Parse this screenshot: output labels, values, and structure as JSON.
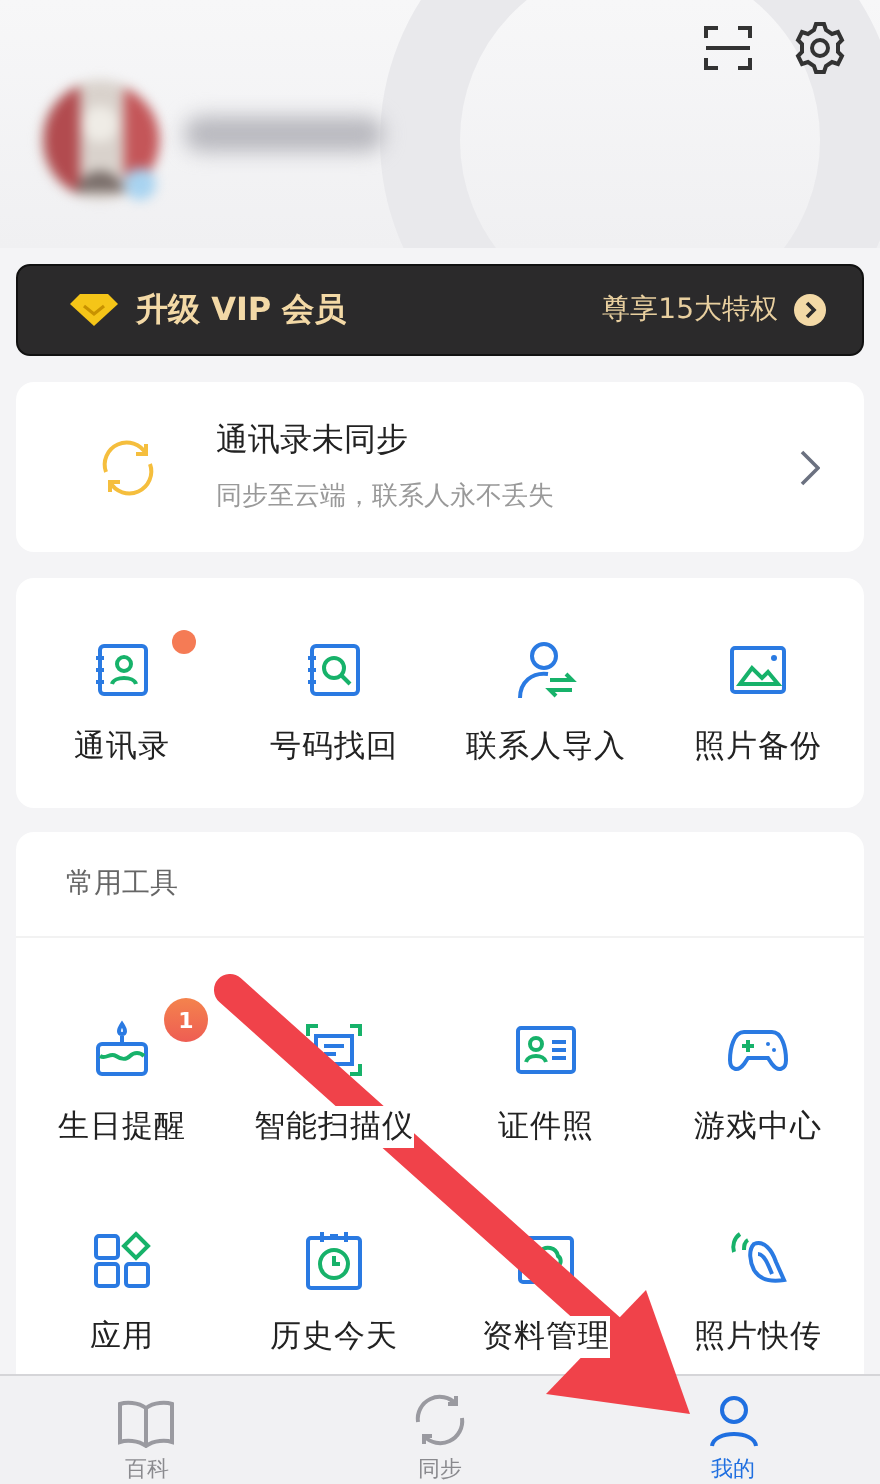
{
  "vip_bar": {
    "title": "升级 VIP 会员",
    "offer": "尊享15大特权"
  },
  "sync_card": {
    "title": "通讯录未同步",
    "subtitle": "同步至云端，联系人永不丢失"
  },
  "quick_actions": [
    {
      "label": "通讯录",
      "dot": true
    },
    {
      "label": "号码找回",
      "dot": false
    },
    {
      "label": "联系人导入",
      "dot": false
    },
    {
      "label": "照片备份",
      "dot": false
    }
  ],
  "tools": {
    "title": "常用工具",
    "items": [
      {
        "label": "生日提醒",
        "badge": "1"
      },
      {
        "label": "智能扫描仪"
      },
      {
        "label": "证件照"
      },
      {
        "label": "游戏中心"
      },
      {
        "label": "应用"
      },
      {
        "label": "历史今天"
      },
      {
        "label": "资料管理"
      },
      {
        "label": "照片快传"
      }
    ]
  },
  "tab_bar": [
    {
      "label": "百科",
      "selected": false
    },
    {
      "label": "同步",
      "selected": false
    },
    {
      "label": "我的",
      "selected": true
    }
  ]
}
